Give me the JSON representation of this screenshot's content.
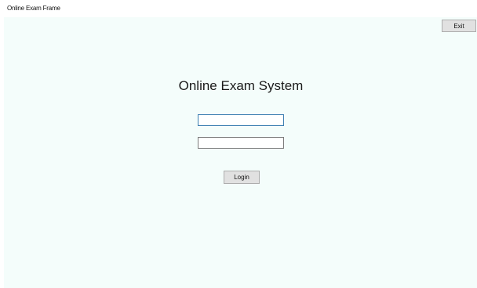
{
  "window": {
    "title": "Online Exam Frame"
  },
  "toolbar": {
    "exit_label": "Exit"
  },
  "main": {
    "heading": "Online Exam System",
    "username_value": "",
    "password_value": "",
    "login_label": "Login"
  },
  "colors": {
    "content_background": "#f4fdfb",
    "button_face": "#e1e1e1",
    "focused_input_border": "#3c7fb1"
  }
}
